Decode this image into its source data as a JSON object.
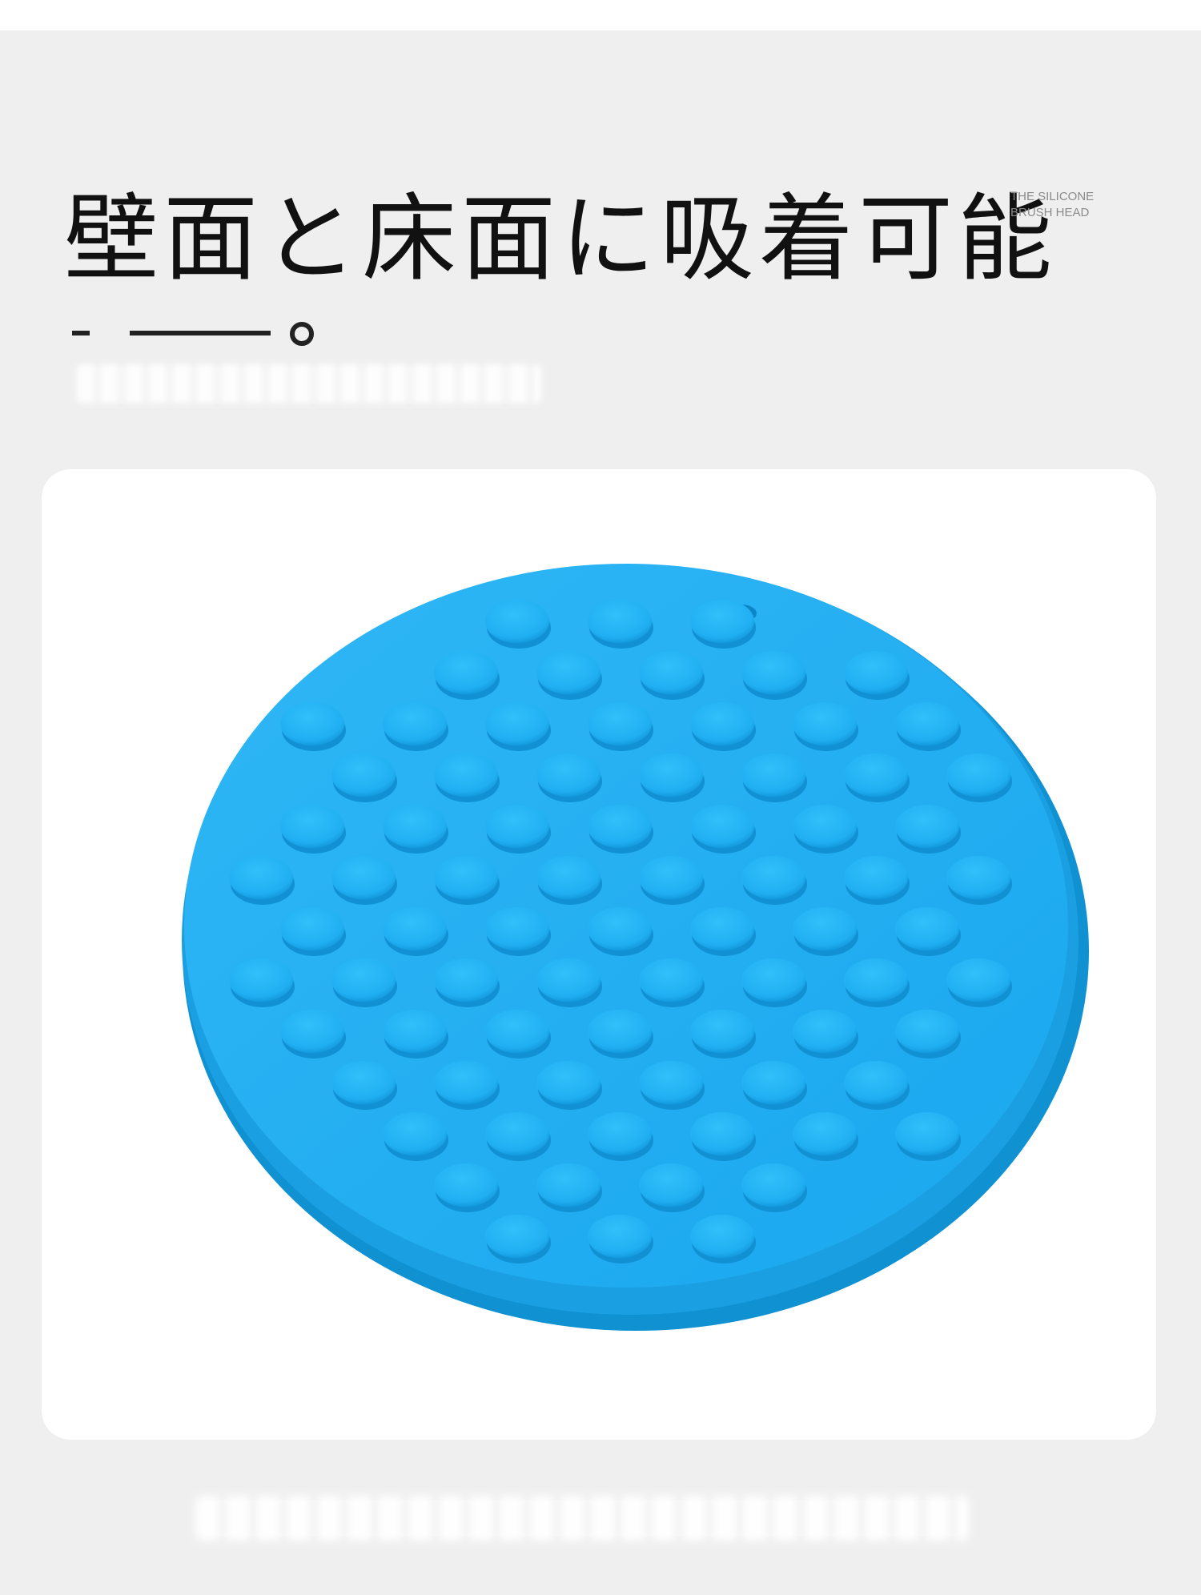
{
  "headline": "壁面と床面に吸着可能",
  "watermark": {
    "line1": "THE SILICONE",
    "line2": "BRUSH HEAD"
  },
  "product": {
    "name": "silicone suction pad",
    "color": "#1eaaf0"
  },
  "background_color": "#efefef",
  "card_color": "#ffffff"
}
